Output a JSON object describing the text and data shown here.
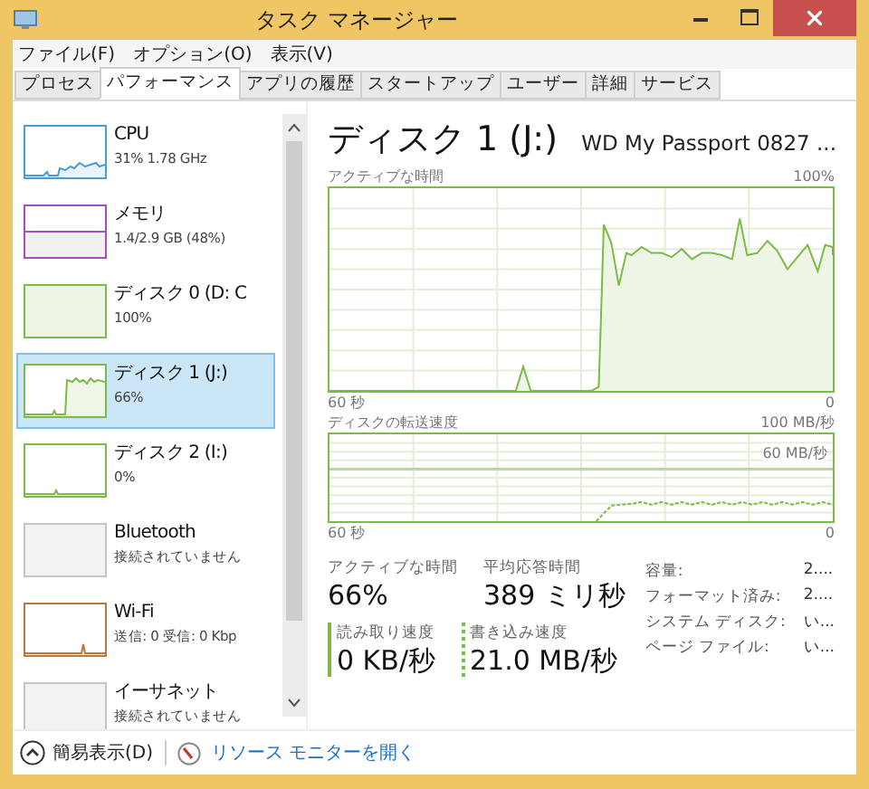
{
  "window": {
    "title": "タスク マネージャー"
  },
  "menu": [
    {
      "label": "ファイル(F)"
    },
    {
      "label": "オプション(O)"
    },
    {
      "label": "表示(V)"
    }
  ],
  "tabs": [
    {
      "label": "プロセス",
      "selected": false
    },
    {
      "label": "パフォーマンス",
      "selected": true
    },
    {
      "label": "アプリの履歴",
      "selected": false
    },
    {
      "label": "スタートアップ",
      "selected": false
    },
    {
      "label": "ユーザー",
      "selected": false
    },
    {
      "label": "詳細",
      "selected": false
    },
    {
      "label": "サービス",
      "selected": false
    }
  ],
  "sidebar": {
    "items": [
      {
        "name": "CPU",
        "detail": "31% 1.78 GHz",
        "color": "#4a9bd6",
        "selected": false
      },
      {
        "name": "メモリ",
        "detail": "1.4/2.9 GB (48%)",
        "color": "#a64fc4",
        "selected": false
      },
      {
        "name": "ディスク 0 (D: C",
        "detail": "100%",
        "color": "#7cbb48",
        "selected": false
      },
      {
        "name": "ディスク 1 (J:)",
        "detail": "66%",
        "color": "#7cbb48",
        "selected": true
      },
      {
        "name": "ディスク 2 (I:)",
        "detail": "0%",
        "color": "#7cbb48",
        "selected": false
      },
      {
        "name": "Bluetooth",
        "detail": "接続されていません",
        "color": "#c4c4c4",
        "selected": false
      },
      {
        "name": "Wi-Fi",
        "detail": "送信: 0 受信: 0 Kbp",
        "color": "#c0783a",
        "selected": false
      },
      {
        "name": "イーサネット",
        "detail": "接続されていません",
        "color": "#c4c4c4",
        "selected": false
      }
    ]
  },
  "detail": {
    "title": "ディスク 1 (J:)",
    "model": "WD My Passport 0827 ...",
    "active_graph": {
      "label": "アクティブな時間",
      "max": "100%",
      "time_start": "60 秒",
      "time_end": "0"
    },
    "transfer_graph": {
      "label": "ディスクの転送速度",
      "max": "100 MB/秒",
      "scale": "60 MB/秒",
      "time_start": "60 秒",
      "time_end": "0"
    },
    "stats": [
      {
        "label": "アクティブな時間",
        "value": "66%"
      },
      {
        "label": "平均応答時間",
        "value": "389 ミリ秒"
      }
    ],
    "rates": [
      {
        "kind": "read",
        "label": "読み取り速度",
        "value": "0 KB/秒"
      },
      {
        "kind": "write",
        "label": "書き込み速度",
        "value": "21.0 MB/秒"
      }
    ],
    "properties": [
      {
        "label": "容量:",
        "value": "2...."
      },
      {
        "label": "フォーマット済み:",
        "value": "2...."
      },
      {
        "label": "システム ディスク:",
        "value": "い..."
      },
      {
        "label": "ページ ファイル:",
        "value": "い..."
      }
    ]
  },
  "footer": {
    "fewer_details": "簡易表示(D)",
    "resource_monitor": "リソース モニターを開く"
  }
}
